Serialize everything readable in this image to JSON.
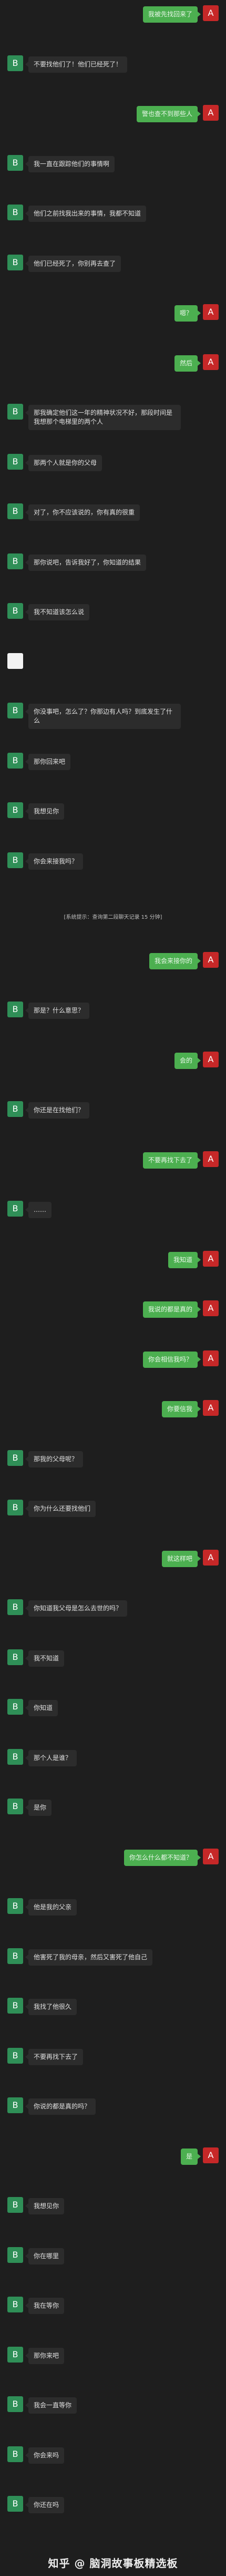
{
  "colors": {
    "background": "#1e1e1e",
    "right_bubble": "#4caf50",
    "left_bubble": "#2c2c2c",
    "avatar_b": "#2f8f57",
    "avatar_a": "#c62828"
  },
  "avatars": {
    "b": "B",
    "a": "A"
  },
  "messages": [
    {
      "side": "right",
      "text": "我被先找回来了"
    },
    {
      "side": "left",
      "text": "不要找他们了！他们已经死了！"
    },
    {
      "side": "right",
      "text": "警也查不到那些人"
    },
    {
      "side": "left",
      "text": "我一直在跟踪他们的事情啊"
    },
    {
      "side": "left",
      "text": "他们之前找我出来的事情，我都不知道"
    },
    {
      "side": "left",
      "text": "他们已经死了，你别再去查了"
    },
    {
      "side": "right",
      "text": "嗯？"
    },
    {
      "side": "right",
      "text": "然后"
    },
    {
      "side": "left",
      "text": "那我确定他们这一年的精神状况不好，那段时间是我想那个电梯里的两个人"
    },
    {
      "side": "left",
      "text": "那两个人就是你的父母"
    },
    {
      "side": "left",
      "text": "对了，你不应该说的，你有真的很重"
    },
    {
      "side": "left",
      "text": "那你说吧，告诉我好了，你知道的结果"
    },
    {
      "side": "left",
      "text": "我不知道该怎么说"
    },
    {
      "side": "left",
      "text": "",
      "avatar": "w"
    },
    {
      "side": "left",
      "text": "你没事吧，怎么了？你那边有人吗？到底发生了什么"
    },
    {
      "side": "left",
      "text": "那你回来吧"
    },
    {
      "side": "left",
      "text": "我想见你"
    },
    {
      "side": "left",
      "text": "你会来接我吗？"
    },
    {
      "system": "[系统提示：查询第二段聊天记录 15 分钟]"
    },
    {
      "side": "right",
      "text": "我会来接你的"
    },
    {
      "side": "left",
      "text": "那是？什么意思？"
    },
    {
      "side": "right",
      "text": "会的"
    },
    {
      "side": "left",
      "text": "你还是在找他们？"
    },
    {
      "side": "right",
      "text": "不要再找下去了"
    },
    {
      "side": "left",
      "text": "……"
    },
    {
      "side": "right",
      "text": "我知道"
    },
    {
      "side": "right",
      "text": "我说的都是真的"
    },
    {
      "side": "right",
      "text": "你会相信我吗？"
    },
    {
      "side": "right",
      "text": "你要信我"
    },
    {
      "side": "left",
      "text": "那我的父母呢？"
    },
    {
      "side": "left",
      "text": "你为什么还要找他们"
    },
    {
      "side": "right",
      "text": "就这样吧"
    },
    {
      "side": "left",
      "text": "你知道我父母是怎么去世的吗？"
    },
    {
      "side": "left",
      "text": "我不知道"
    },
    {
      "side": "left",
      "text": "你知道"
    },
    {
      "side": "left",
      "text": "那个人是谁？"
    },
    {
      "side": "left",
      "text": "是你"
    },
    {
      "side": "right",
      "text": "你怎么什么都不知道？"
    },
    {
      "side": "left",
      "text": "他是我的父亲"
    },
    {
      "side": "left",
      "text": "他害死了我的母亲，然后又害死了他自己"
    },
    {
      "side": "left",
      "text": "我找了他很久"
    },
    {
      "side": "left",
      "text": "不要再找下去了"
    },
    {
      "side": "left",
      "text": "你说的都是真的吗？"
    },
    {
      "side": "right",
      "text": "是"
    },
    {
      "side": "left",
      "text": "我想见你"
    },
    {
      "side": "left",
      "text": "你在哪里"
    },
    {
      "side": "left",
      "text": "我在等你"
    },
    {
      "side": "left",
      "text": "那你来吧"
    },
    {
      "side": "left",
      "text": "我会一直等你"
    },
    {
      "side": "left",
      "text": "你会来吗"
    },
    {
      "side": "left",
      "text": "你还在吗"
    }
  ],
  "watermark": "知乎 @ 脑洞故事板精选板"
}
